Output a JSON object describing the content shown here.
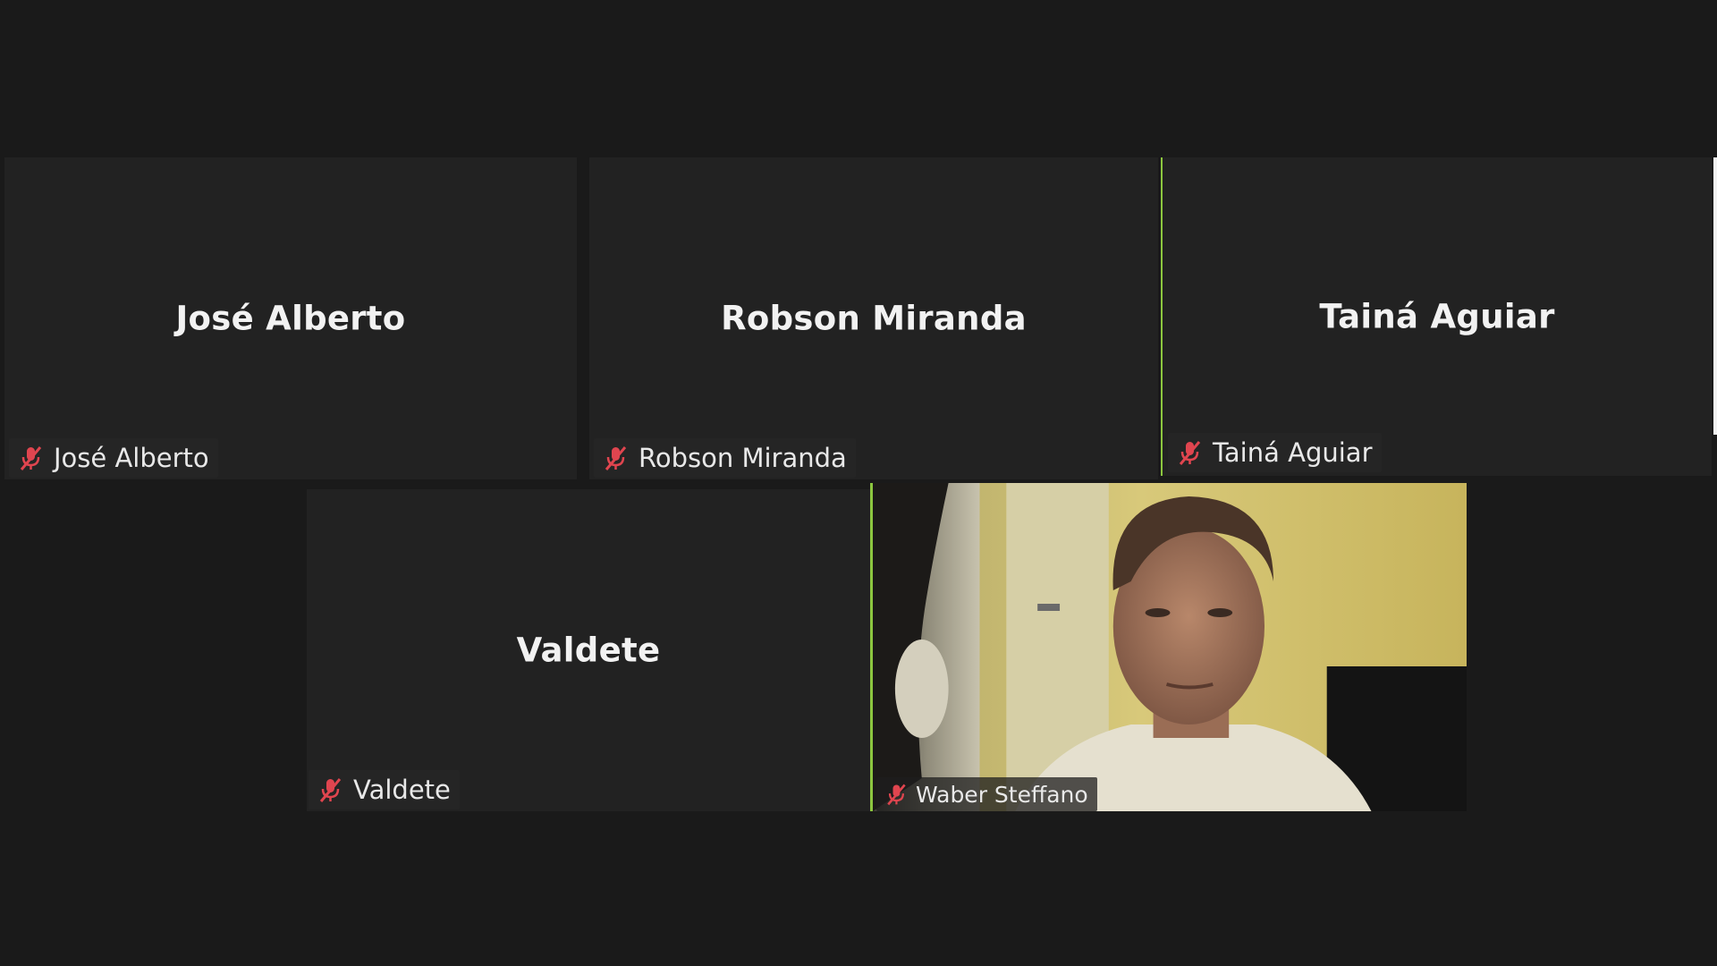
{
  "participants": [
    {
      "name": "José Alberto",
      "label": "José Alberto",
      "muted": true
    },
    {
      "name": "Robson Miranda",
      "label": "Robson Miranda",
      "muted": true
    },
    {
      "name": "Tainá Aguiar",
      "label": "Tainá Aguiar",
      "muted": true
    },
    {
      "name": "Valdete",
      "label": "Valdete",
      "muted": true
    },
    {
      "name": "Waber Steffano",
      "label": "Waber Steffano",
      "muted": true,
      "video_on": true
    }
  ],
  "icons": {
    "muted_mic": "mic-muted-icon"
  },
  "colors": {
    "background": "#1a1a1a",
    "tile": "#222222",
    "active_speaker_border": "#8cc63f",
    "muted_icon": "#e0454f"
  }
}
